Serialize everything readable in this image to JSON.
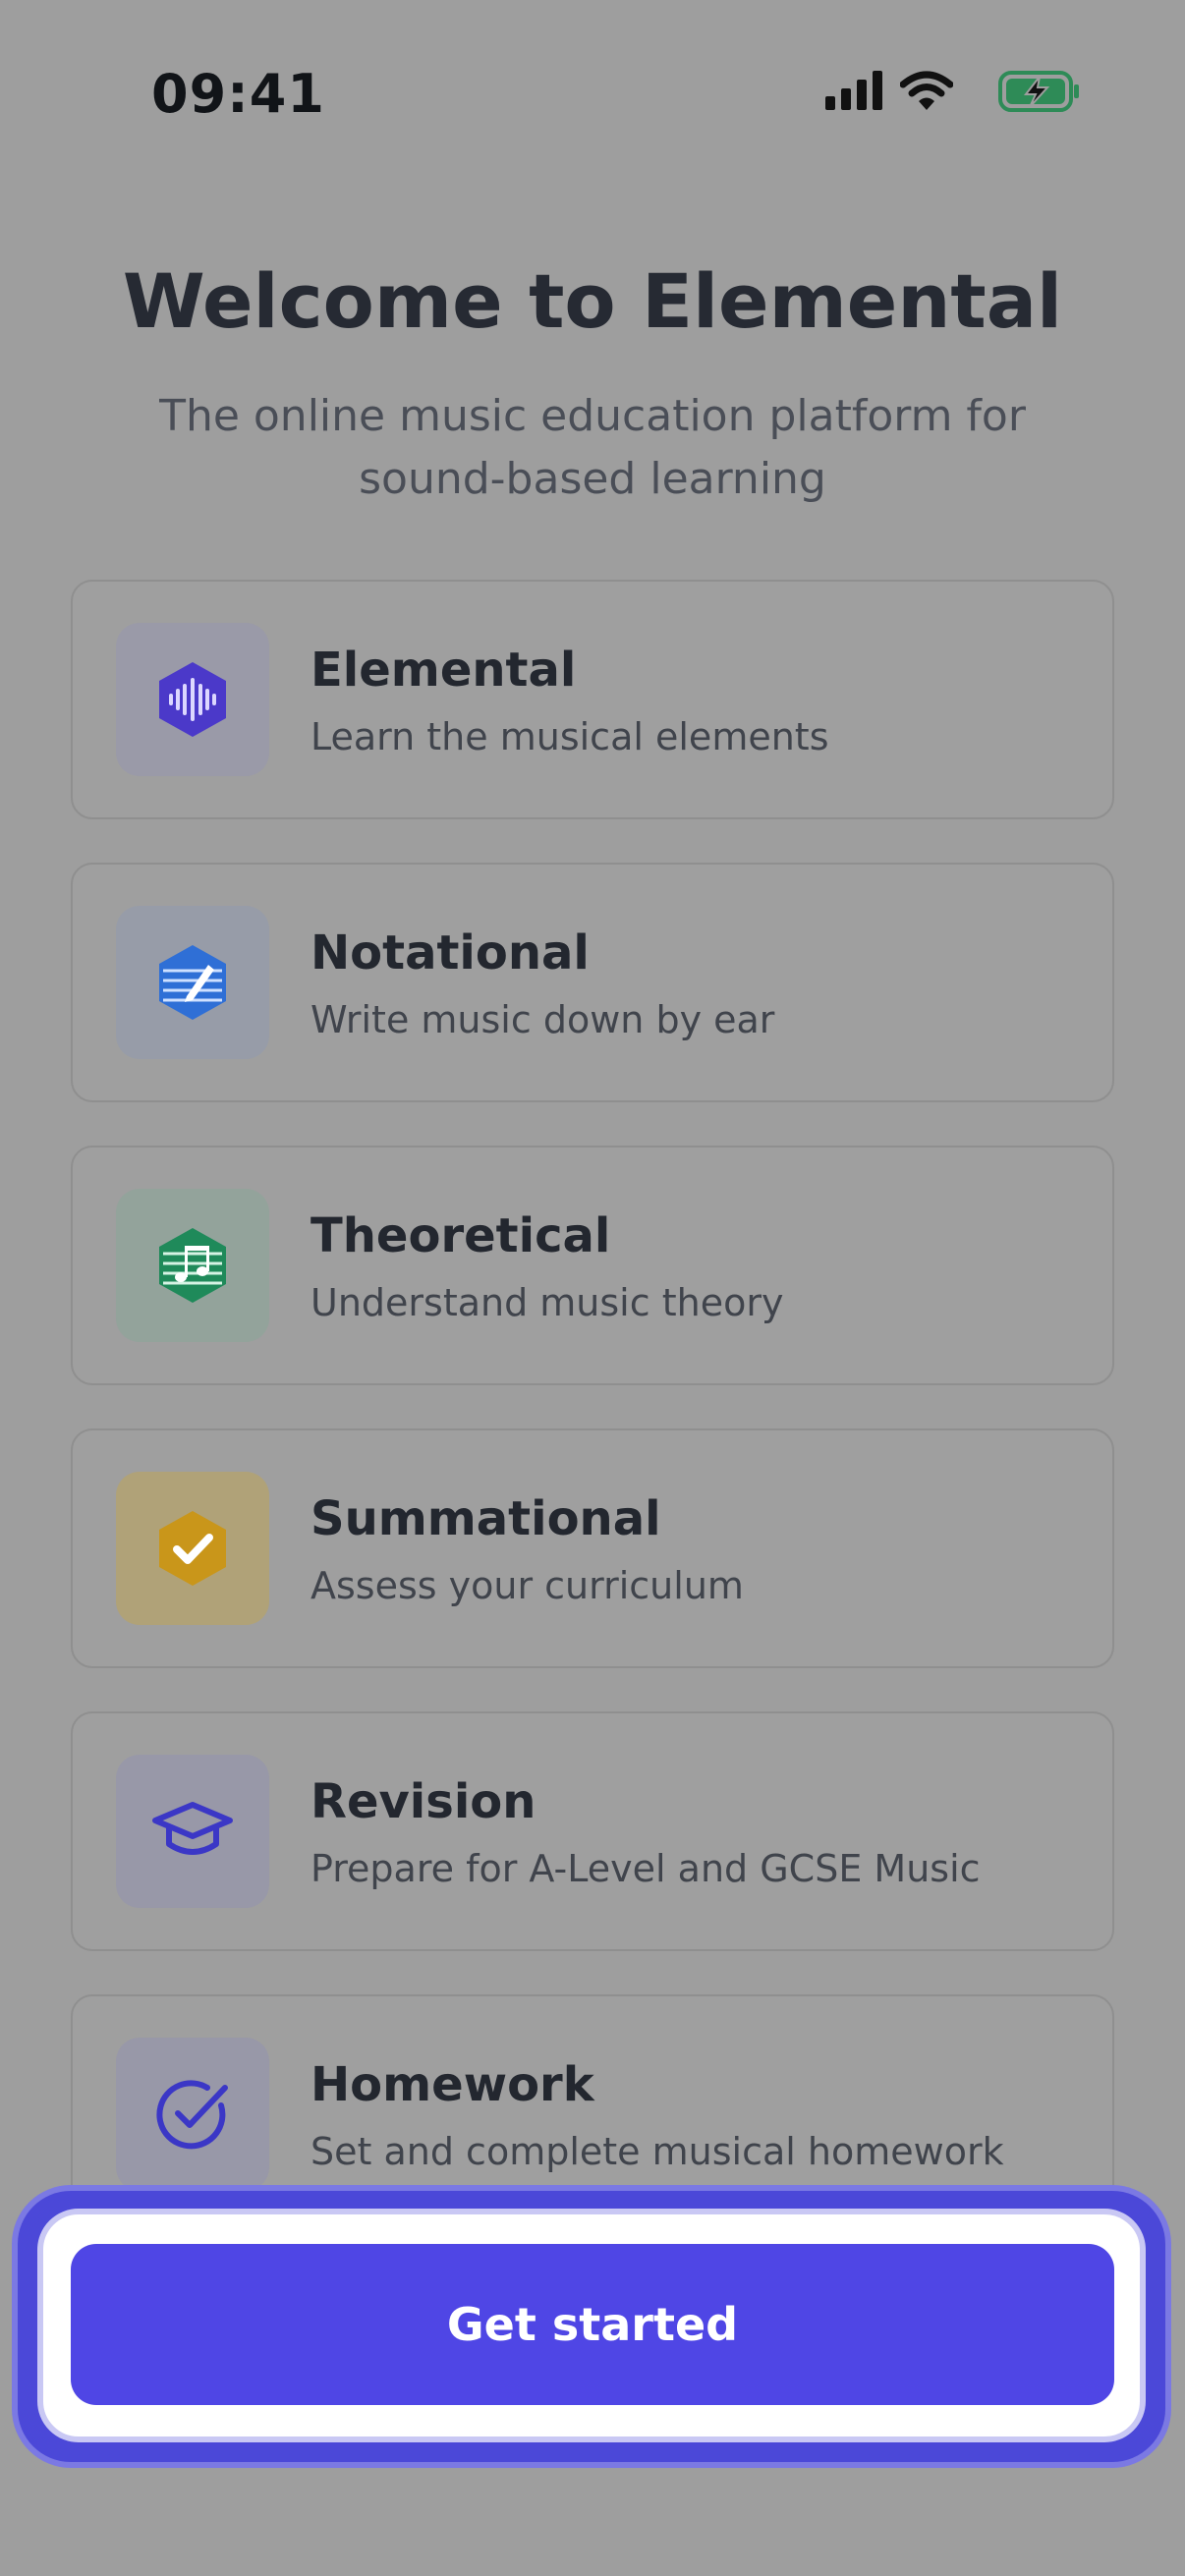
{
  "status_bar": {
    "time": "09:41",
    "icons": [
      "signal-icon",
      "wifi-icon",
      "battery-charging-icon"
    ],
    "battery_color": "#2e8b57"
  },
  "header": {
    "title": "Welcome to Elemental",
    "subtitle": "The online music education platform for sound-based learning"
  },
  "products": [
    {
      "title": "Elemental",
      "description": "Learn the musical elements",
      "icon": "waveform-hexagon-icon",
      "accent": "#4b39c9"
    },
    {
      "title": "Notational",
      "description": "Write music down by ear",
      "icon": "pen-staff-hexagon-icon",
      "accent": "#2f6fd6"
    },
    {
      "title": "Theoretical",
      "description": "Understand music theory",
      "icon": "music-notes-hexagon-icon",
      "accent": "#1f8a5a"
    },
    {
      "title": "Summational",
      "description": "Assess your curriculum",
      "icon": "check-hexagon-icon",
      "accent": "#c9961a"
    },
    {
      "title": "Revision",
      "description": "Prepare for A-Level and GCSE Music",
      "icon": "graduation-cap-icon",
      "accent": "#3b37c6"
    },
    {
      "title": "Homework",
      "description": "Set and complete musical homework",
      "icon": "check-circle-icon",
      "accent": "#3b37c6"
    }
  ],
  "cta": {
    "label": "Get started",
    "color": "#4f46e5"
  }
}
